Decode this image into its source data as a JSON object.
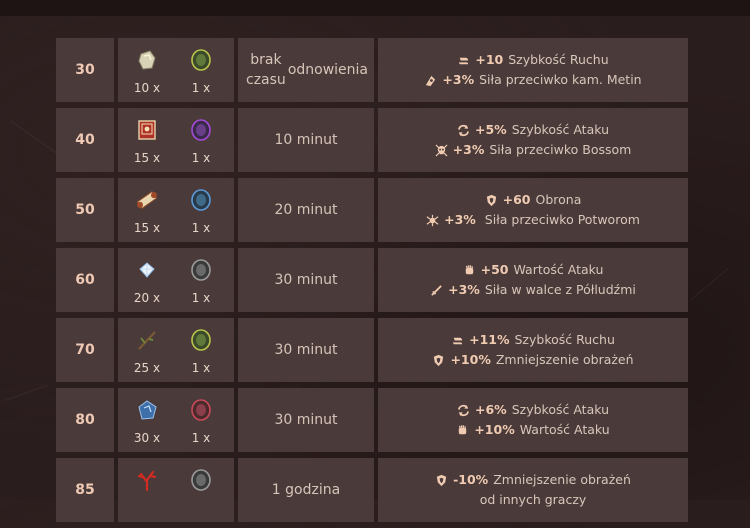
{
  "rows": [
    {
      "level": "30",
      "materials": [
        {
          "qty": "10 x",
          "icon": "stone-ore-icon"
        },
        {
          "qty": "1 x",
          "icon": "green-soul-stone-icon"
        }
      ],
      "cooldown": [
        "brak czasu",
        "odnowienia"
      ],
      "bonuses": [
        {
          "icon": "speed-icon",
          "value": "+10",
          "text": "Szybkość Ruchu"
        },
        {
          "icon": "metin-stone-icon",
          "value": "+3%",
          "text": "Siła przeciwko kam. Metin"
        }
      ]
    },
    {
      "level": "40",
      "materials": [
        {
          "qty": "15 x",
          "icon": "red-book-icon"
        },
        {
          "qty": "1 x",
          "icon": "purple-soul-stone-icon"
        }
      ],
      "cooldown": [
        "10 minut"
      ],
      "bonuses": [
        {
          "icon": "attack-speed-icon",
          "value": "+5%",
          "text": "Szybkość Ataku"
        },
        {
          "icon": "skull-icon",
          "value": "+3%",
          "text": "Siła przeciwko Bossom"
        }
      ]
    },
    {
      "level": "50",
      "materials": [
        {
          "qty": "15 x",
          "icon": "scroll-icon"
        },
        {
          "qty": "1 x",
          "icon": "blue-soul-stone-icon"
        }
      ],
      "cooldown": [
        "20 minut"
      ],
      "bonuses": [
        {
          "icon": "shield-icon",
          "value": "+60",
          "text": "Obrona"
        },
        {
          "icon": "monster-icon",
          "value": "+3%",
          "text": " Siła przeciwko Potworom"
        }
      ]
    },
    {
      "level": "60",
      "materials": [
        {
          "qty": "20 x",
          "icon": "diamond-icon"
        },
        {
          "qty": "1 x",
          "icon": "grey-soul-stone-icon"
        }
      ],
      "cooldown": [
        "30 minut"
      ],
      "bonuses": [
        {
          "icon": "fist-icon",
          "value": "+50",
          "text": "Wartość Ataku"
        },
        {
          "icon": "sword-icon",
          "value": "+3%",
          "text": "Siła w walce z Półludźmi"
        }
      ]
    },
    {
      "level": "70",
      "materials": [
        {
          "qty": "25 x",
          "icon": "branch-icon"
        },
        {
          "qty": "1 x",
          "icon": "green-soul-stone-icon"
        }
      ],
      "cooldown": [
        "30 minut"
      ],
      "bonuses": [
        {
          "icon": "speed-icon",
          "value": "+11%",
          "text": "Szybkość Ruchu"
        },
        {
          "icon": "shield-icon",
          "value": "+10%",
          "text": "Zmniejszenie obrażeń"
        }
      ]
    },
    {
      "level": "80",
      "materials": [
        {
          "qty": "30 x",
          "icon": "blue-crystal-icon"
        },
        {
          "qty": "1 x",
          "icon": "red-soul-stone-icon"
        }
      ],
      "cooldown": [
        "30 minut"
      ],
      "bonuses": [
        {
          "icon": "attack-speed-icon",
          "value": "+6%",
          "text": "Szybkość Ataku"
        },
        {
          "icon": "fist-icon",
          "value": "+10%",
          "text": "Wartość Ataku"
        }
      ]
    },
    {
      "level": "85",
      "materials": [
        {
          "qty": "",
          "icon": "red-coral-icon"
        },
        {
          "qty": "",
          "icon": "grey-soul-stone-icon"
        }
      ],
      "cooldown": [
        "1 godzina"
      ],
      "bonuses": [
        {
          "icon": "shield-icon",
          "value": "-10%",
          "text": "Zmniejszenie obrażeń"
        },
        {
          "icon": "",
          "value": "",
          "text": "od innych graczy"
        }
      ]
    }
  ],
  "colors": {
    "cell": "#4a3b3a",
    "background": "#2a1d1d",
    "level_text": "#f0c9b5"
  }
}
